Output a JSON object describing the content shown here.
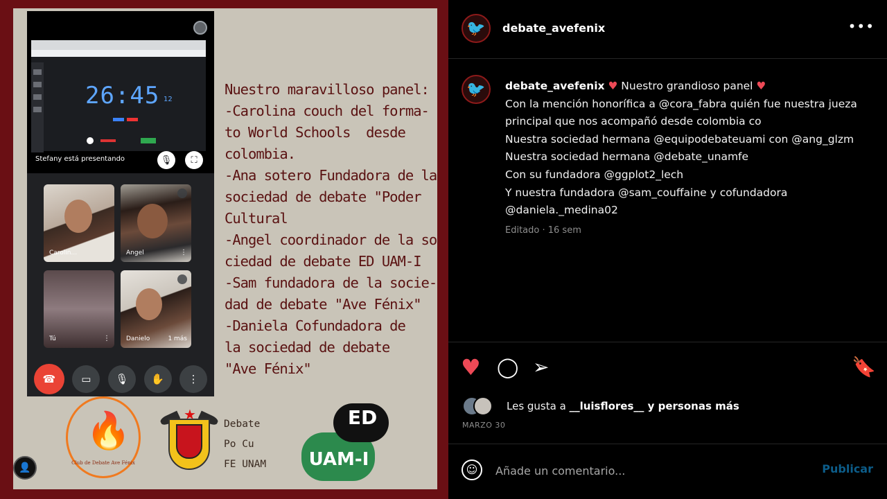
{
  "image": {
    "presenting_label": "Stefany está presentando",
    "timer": "26:45",
    "timer_sub": "12",
    "participants": [
      {
        "name": "Carolin..."
      },
      {
        "name": "Angel"
      },
      {
        "name": "Tú"
      },
      {
        "name": "Danielo"
      }
    ],
    "more_label": "1 más",
    "panel_lines": [
      "Nuestro maravilloso panel:",
      "-Carolina couch del forma-",
      "to World Schools  desde",
      "colombia.",
      "-Ana sotero Fundadora de la",
      "sociedad de debate \"Poder",
      "Cultural",
      "-Angel coordinador de la so-",
      "ciedad de debate ED UAM-I",
      "-Sam fundadora de la socie-",
      "dad de debate \"Ave Fénix\"",
      "-Daniela Cofundadora de",
      "la sociedad de debate",
      "\"Ave Fénix\""
    ],
    "logo_avefenix_caption": "Club de Debate Ave Fénix",
    "debate_pocu_lines": [
      "Debate",
      "Po Cu",
      "FE UNAM"
    ],
    "logo_ed": "ED",
    "logo_uami": "UAM-I",
    "colors": {
      "frame": "#6a0f14",
      "poster_bg": "#c9c4b8",
      "text": "#5a1212"
    }
  },
  "post": {
    "username": "debate_avefenix",
    "more_icon": "more-horizontal-icon",
    "caption": {
      "username": "debate_avefenix",
      "heart": "♥",
      "title": " Nuestro grandioso panel ",
      "lines": [
        "Con la mención honorífica  a @cora_fabra quién fue nuestra jueza",
        "principal que nos acompañó desde colombia co",
        "Nuestra sociedad hermana @equipodebateuami con @ang_glzm",
        "Nuestra sociedad hermana @debate_unamfe",
        "Con su fundadora @ggplot2_lech",
        "Y nuestra fundadora @sam_couffaine y cofundadora",
        "@daniela._medina02"
      ],
      "meta": "Editado · 16 sem"
    },
    "likes": {
      "prefix": "Les gusta a ",
      "user": "__luisflores__",
      "suffix": " y personas más"
    },
    "date": "MARZO 30",
    "comment_placeholder": "Añade un comentario...",
    "publish_label": "Publicar",
    "colors": {
      "like": "#ed4956",
      "publish": "#0c5d8a",
      "meta": "#8e8e8e"
    }
  }
}
